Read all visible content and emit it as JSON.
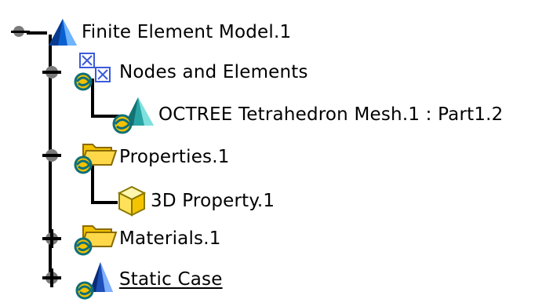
{
  "tree": {
    "root": {
      "label": "Finite Element Model.1",
      "icon": "fem-model-icon",
      "expanded": true
    },
    "items": [
      {
        "label": "Nodes and Elements",
        "icon": "nodes-elements-icon",
        "expanded": true,
        "children": [
          {
            "label": "OCTREE Tetrahedron Mesh.1 : Part1.2",
            "icon": "tetra-mesh-icon"
          }
        ]
      },
      {
        "label": "Properties.1",
        "icon": "properties-folder-icon",
        "expanded": true,
        "children": [
          {
            "label": "3D Property.1",
            "icon": "3d-property-icon"
          }
        ]
      },
      {
        "label": "Materials.1",
        "icon": "materials-folder-icon",
        "expanded": false
      },
      {
        "label": "Static Case",
        "icon": "static-case-icon",
        "expanded": false,
        "underlined": true
      }
    ]
  },
  "colors": {
    "branch_line": "#000000",
    "toggle_ball": "#7a7a7a",
    "folder_yellow": "#f2c200",
    "mesh_teal": "#2aa5a5",
    "cube_yellow": "#ffe25a",
    "model_blue": "#0a5fd1"
  }
}
